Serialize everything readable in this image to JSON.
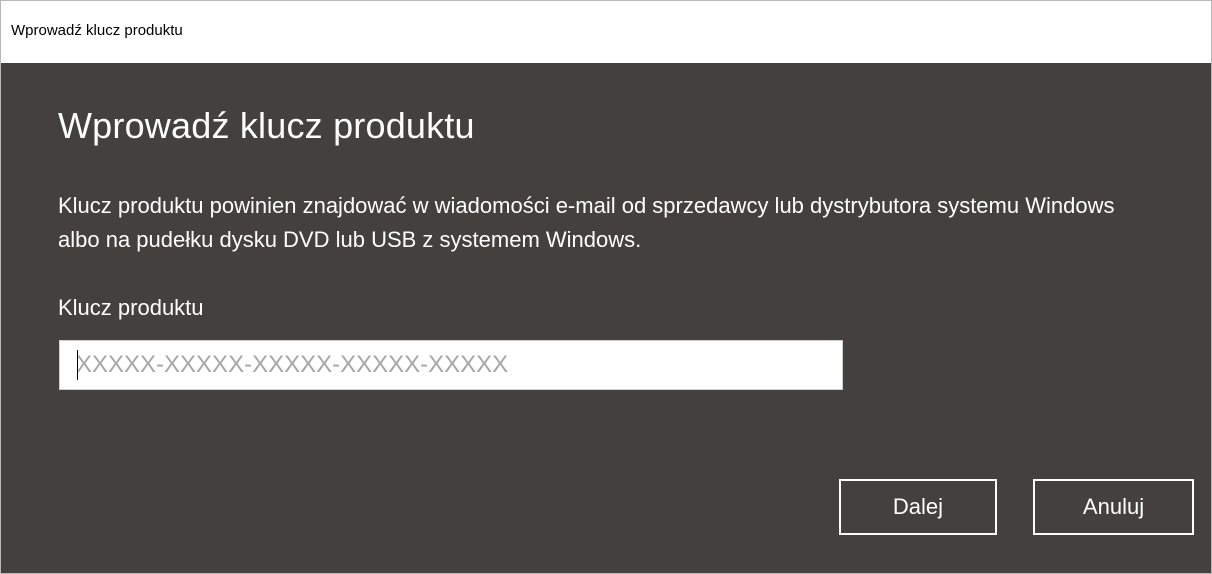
{
  "window": {
    "title": "Wprowadź klucz produktu"
  },
  "dialog": {
    "heading": "Wprowadź klucz produktu",
    "description": "Klucz produktu powinien znajdować w wiadomości e-mail od sprzedawcy lub dystrybutora systemu Windows albo na pudełku dysku DVD lub USB z systemem Windows.",
    "field_label": "Klucz produktu",
    "key_input": {
      "value": "",
      "placeholder": "XXXXX-XXXXX-XXXXX-XXXXX-XXXXX"
    },
    "buttons": {
      "next_label": "Dalej",
      "cancel_label": "Anuluj"
    }
  },
  "colors": {
    "dialog_background": "#43403d",
    "titlebar_background": "#ffffff",
    "text_primary": "#ffffff",
    "placeholder_text": "#a7a7a7"
  }
}
